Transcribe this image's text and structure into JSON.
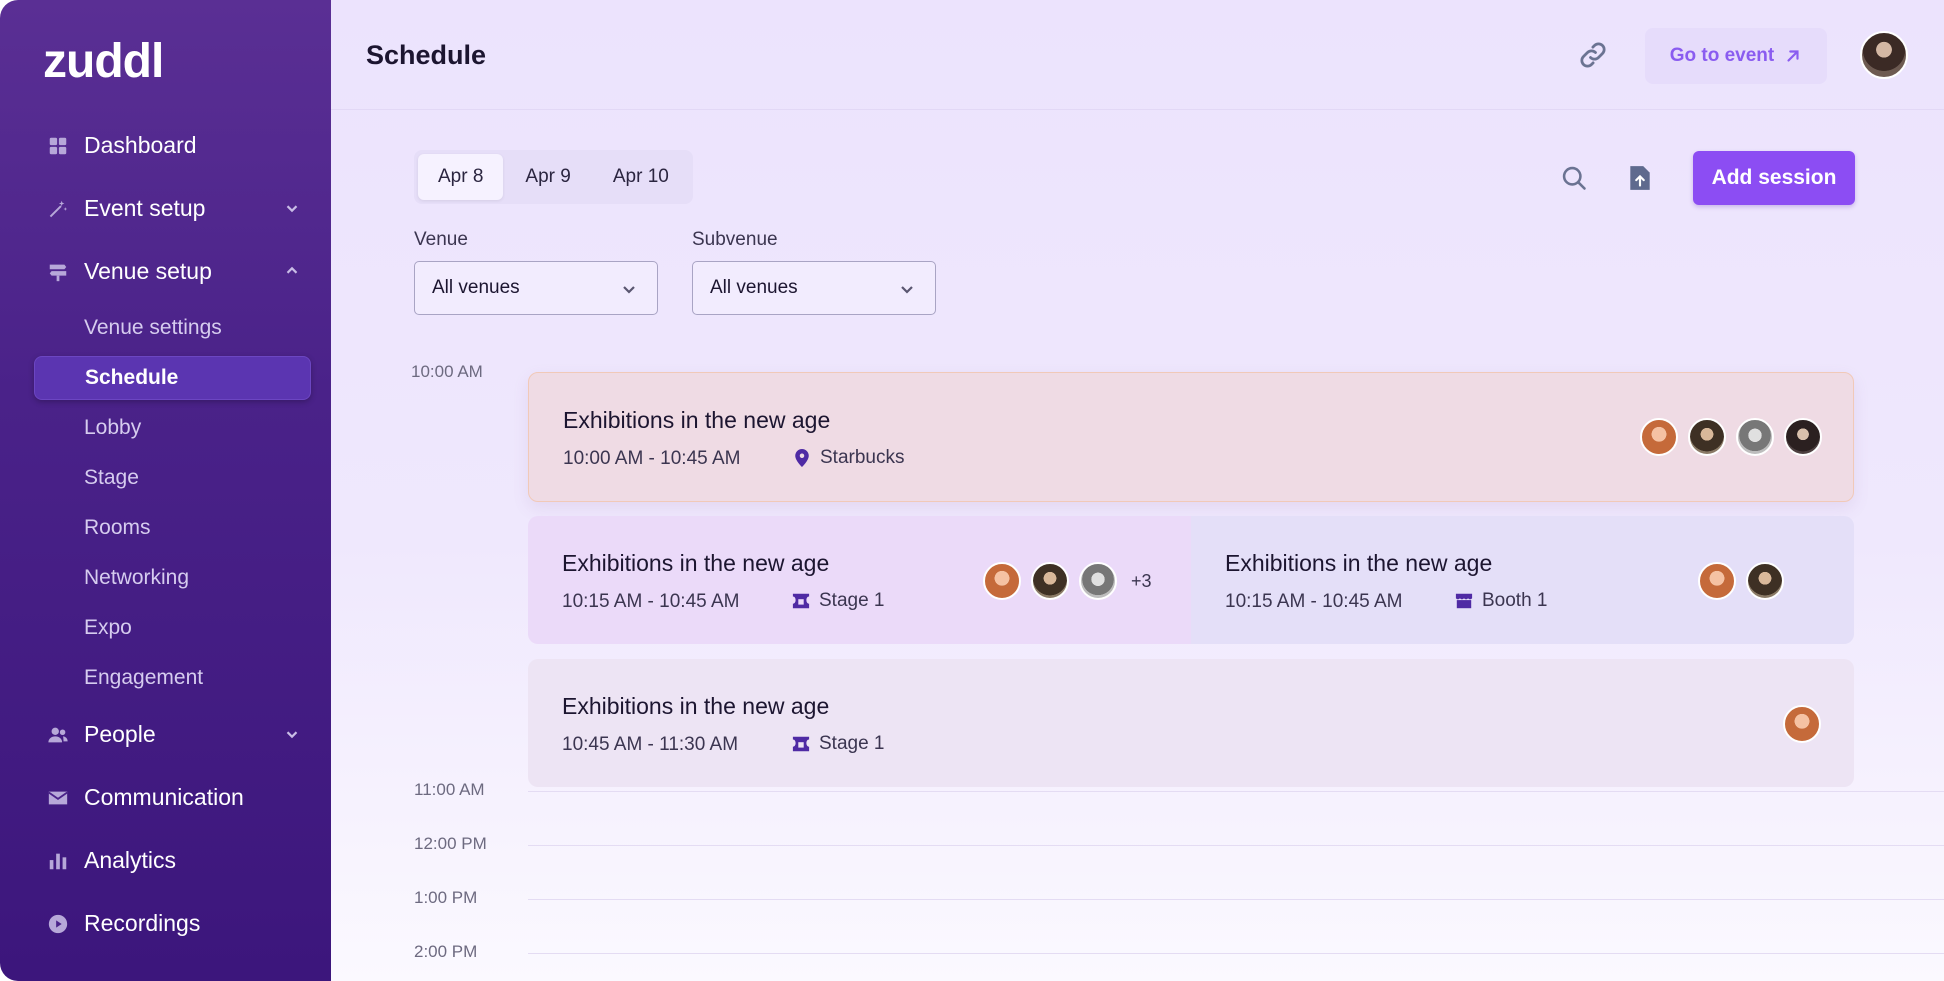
{
  "sidebar": {
    "logo": "zuddl",
    "items": [
      {
        "label": "Dashboard",
        "icon": "grid-icon"
      },
      {
        "label": "Event setup",
        "icon": "magic-wand-icon",
        "expanded": false
      },
      {
        "label": "Venue setup",
        "icon": "signpost-icon",
        "expanded": true
      },
      {
        "label": "People",
        "icon": "people-icon",
        "expanded": false
      },
      {
        "label": "Communication",
        "icon": "mail-icon"
      },
      {
        "label": "Analytics",
        "icon": "bar-chart-icon"
      },
      {
        "label": "Recordings",
        "icon": "play-icon"
      }
    ],
    "venue_subitems": [
      "Venue settings",
      "Schedule",
      "Lobby",
      "Stage",
      "Rooms",
      "Networking",
      "Expo",
      "Engagement"
    ],
    "active_subitem": "Schedule"
  },
  "header": {
    "title": "Schedule",
    "go_to_event": "Go to event"
  },
  "toolbar": {
    "dates": [
      "Apr 8",
      "Apr 9",
      "Apr 10"
    ],
    "active_date": "Apr 8",
    "add_session": "Add session"
  },
  "filters": {
    "venue_label": "Venue",
    "venue_value": "All venues",
    "subvenue_label": "Subvenue",
    "subvenue_value": "All venues"
  },
  "timeline": {
    "hours": [
      "10:00 AM",
      "11:00 AM",
      "12:00 PM",
      "1:00 PM",
      "2:00 PM"
    ]
  },
  "sessions": [
    {
      "title": "Exhibitions in the new age",
      "time": "10:00 AM - 10:45 AM",
      "location": "Starbucks",
      "location_icon": "map-pin-icon",
      "avatars": 4,
      "more": "",
      "color": "#efdbe4"
    },
    {
      "title": "Exhibitions in the new age",
      "time": "10:15 AM - 10:45 AM",
      "location": "Stage 1",
      "location_icon": "stage-icon",
      "avatars": 3,
      "more": "+3",
      "color": "#ebdaf9"
    },
    {
      "title": "Exhibitions in the new age",
      "time": "10:15 AM - 10:45 AM",
      "location": "Booth 1",
      "location_icon": "booth-icon",
      "avatars": 2,
      "more": "",
      "color": "#e4dff8"
    },
    {
      "title": "Exhibitions in the new age",
      "time": "10:45 AM - 11:30 AM",
      "location": "Stage 1",
      "location_icon": "stage-icon",
      "avatars": 1,
      "more": "",
      "color": "#ede4f4"
    }
  ],
  "colors": {
    "accent": "#8c4df3",
    "sidebar_top": "#5a2f94",
    "sidebar_bottom": "#3c167c",
    "active_item": "#5b35b1"
  }
}
